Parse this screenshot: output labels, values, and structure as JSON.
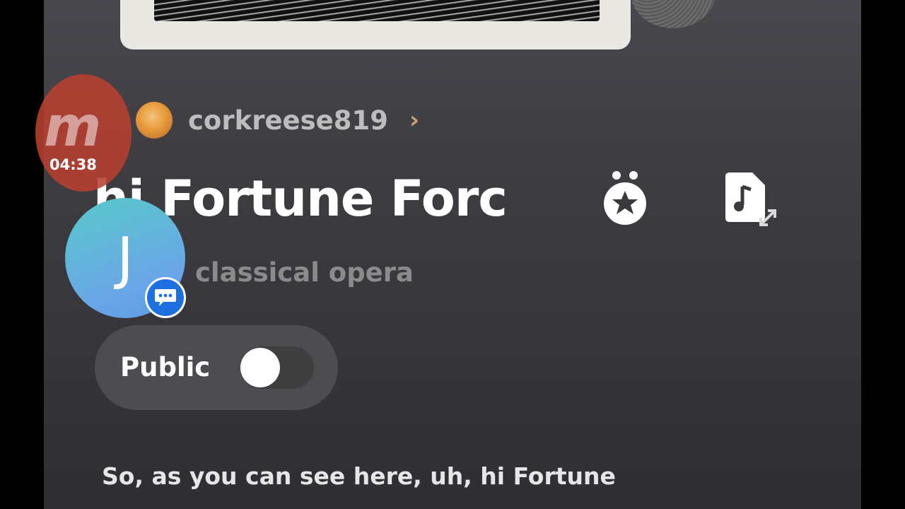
{
  "song": {
    "author": "corkreese819",
    "title": "hi Fortune Forc",
    "genre": "classical opera"
  },
  "visibility": {
    "label": "Public",
    "enabled": false
  },
  "lyrics": {
    "line1": "So, as you can see here, uh, hi Fortune"
  },
  "recorder": {
    "time": "04:38",
    "logo_text": "m"
  },
  "chat_head": {
    "initial": "J"
  },
  "icons": {
    "author_chevron": "chevron-right-icon",
    "medal": "medal-star-icon",
    "song_file": "music-file-expand-icon",
    "chat": "chat-bubble-icon"
  },
  "colors": {
    "background": "#3b3b40",
    "chevron_accent": "#c9a27a",
    "recorder": "#b84030",
    "chat_badge": "#1e6fe0"
  }
}
